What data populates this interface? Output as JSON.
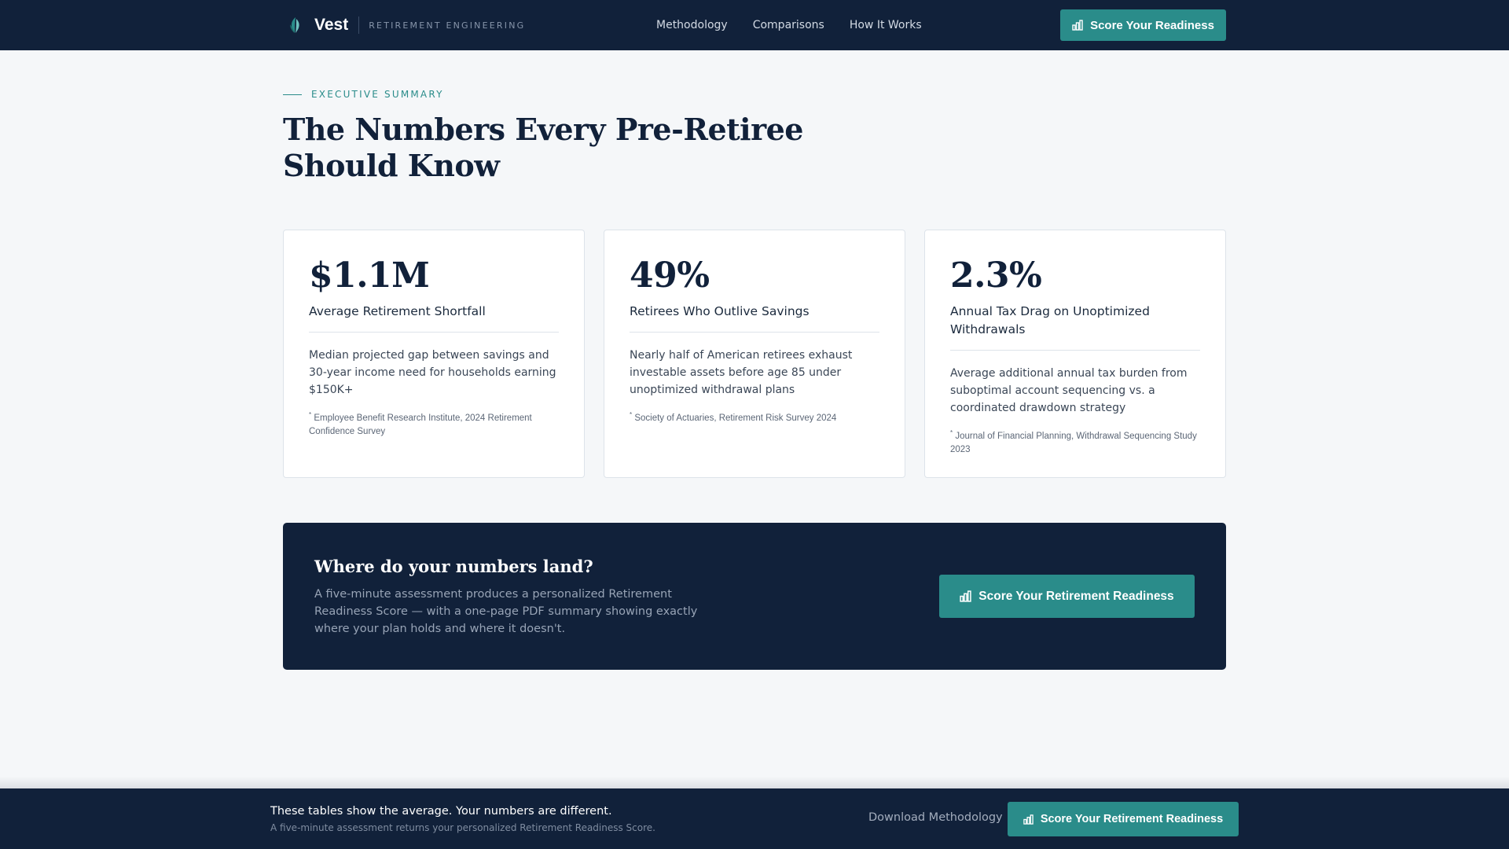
{
  "nav": {
    "brand_name": "Vest",
    "brand_tagline": "RETIREMENT ENGINEERING",
    "links": [
      "Methodology",
      "Comparisons",
      "How It Works"
    ],
    "cta_label": "Score Your Readiness"
  },
  "header": {
    "eyebrow": "EXECUTIVE SUMMARY",
    "title": "The Numbers Every Pre-Retiree Should Know"
  },
  "stats": [
    {
      "value": "$1.1M",
      "label": "Average Retirement Shortfall",
      "description": "Median projected gap between savings and 30-year income need for households earning $150K+",
      "source": "Employee Benefit Research Institute, 2024 Retirement Confidence Survey"
    },
    {
      "value": "49%",
      "label": "Retirees Who Outlive Savings",
      "description": "Nearly half of American retirees exhaust investable assets before age 85 under unoptimized withdrawal plans",
      "source": "Society of Actuaries, Retirement Risk Survey 2024"
    },
    {
      "value": "2.3%",
      "label": "Annual Tax Drag on Unoptimized Withdrawals",
      "description": "Average additional annual tax burden from suboptimal account sequencing vs. a coordinated drawdown strategy",
      "source": "Journal of Financial Planning, Withdrawal Sequencing Study 2023"
    }
  ],
  "source_marker": "*",
  "cta_band": {
    "title": "Where do your numbers land?",
    "text": "A five-minute assessment produces a personalized Retirement Readiness Score — with a one-page PDF summary showing exactly where your plan holds and where it doesn't.",
    "button_label": "Score Your Retirement Readiness"
  },
  "bottom_bar": {
    "title": "These tables show the average. Your numbers are different.",
    "subtitle": "A five-minute assessment returns your personalized Retirement Readiness Score.",
    "link_label": "Download Methodology",
    "button_label": "Score Your Retirement Readiness"
  },
  "colors": {
    "navy": "#11213a",
    "teal": "#2a8c8a",
    "background": "#f5f7f9"
  },
  "icons": {
    "brand": "leaf-icon",
    "cta": "bar-chart-icon"
  }
}
